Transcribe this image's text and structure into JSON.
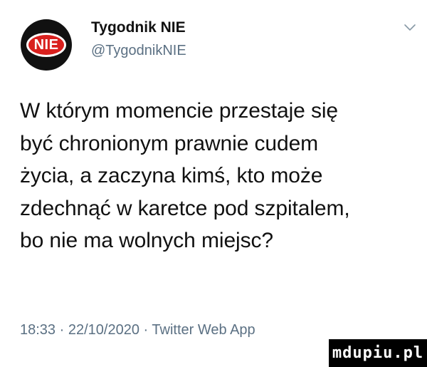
{
  "user": {
    "avatar_text": "NIE",
    "display_name": "Tygodnik NIE",
    "handle": "@TygodnikNIE"
  },
  "tweet": {
    "lines": [
      "W którym momencie przestaje się",
      "być chronionym prawnie cudem",
      "życia, a zaczyna kimś, kto może",
      "zdechnąć w karetce pod szpitalem,",
      "bo nie ma wolnych miejsc?"
    ],
    "time": "18:33",
    "date": "22/10/2020",
    "separator": "·",
    "source": "Twitter Web App"
  },
  "watermark": {
    "text": "mdupiu.pl"
  },
  "colors": {
    "accent_red": "#d9201e",
    "secondary_text": "#5b7083",
    "avatar_bg": "#111111"
  },
  "icons": {
    "menu": "chevron-down-icon"
  }
}
